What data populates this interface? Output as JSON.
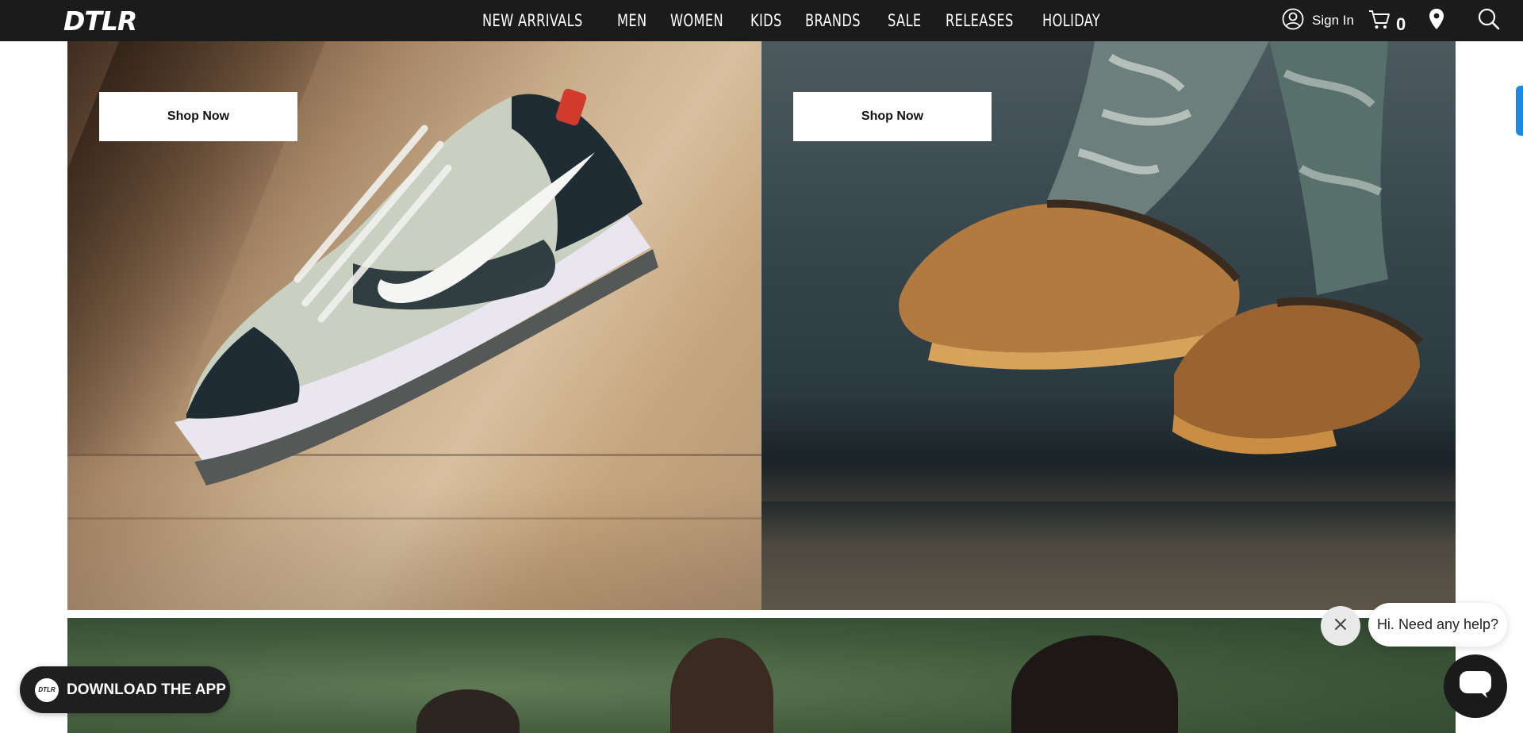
{
  "brand": {
    "logo_text": "DTLR"
  },
  "nav": {
    "items": [
      {
        "label": "NEW ARRIVALS"
      },
      {
        "label": "MEN"
      },
      {
        "label": "WOMEN"
      },
      {
        "label": "KIDS"
      },
      {
        "label": "BRANDS"
      },
      {
        "label": "SALE"
      },
      {
        "label": "RELEASES"
      },
      {
        "label": "HOLIDAY"
      }
    ]
  },
  "header": {
    "sign_in_label": "Sign In",
    "cart_count": "0"
  },
  "hero": {
    "left": {
      "button_label": "Shop Now"
    },
    "right": {
      "button_label": "Shop Now"
    }
  },
  "widgets": {
    "app_banner_label": "DOWNLOAD THE APP",
    "app_logo_text": "DTLR",
    "chat_greeting": "Hi. Need any help?"
  },
  "colors": {
    "header_bg": "#1b1b1b",
    "side_tab": "#1e88e5"
  },
  "icons": {
    "account": "user-circle-icon",
    "cart": "cart-icon",
    "location": "map-pin-icon",
    "search": "search-icon",
    "close": "close-icon",
    "chat": "chat-icon"
  }
}
